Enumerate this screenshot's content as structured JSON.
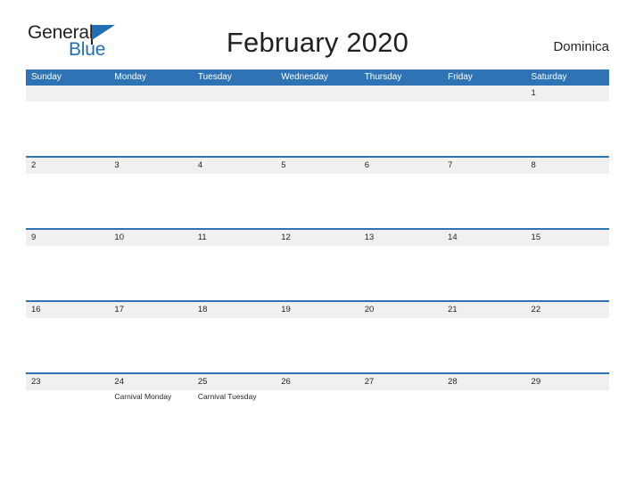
{
  "brand": {
    "name_top": "General",
    "name_bottom": "Blue",
    "flag_icon": "flag-triangle-icon",
    "accent_color": "#1f6fb5"
  },
  "header": {
    "title": "February 2020",
    "region": "Dominica"
  },
  "calendar": {
    "header_color": "#2e74b5",
    "band_color": "#f0f0f0",
    "weekdays": [
      "Sunday",
      "Monday",
      "Tuesday",
      "Wednesday",
      "Thursday",
      "Friday",
      "Saturday"
    ],
    "weeks": [
      [
        {
          "day": "",
          "events": []
        },
        {
          "day": "",
          "events": []
        },
        {
          "day": "",
          "events": []
        },
        {
          "day": "",
          "events": []
        },
        {
          "day": "",
          "events": []
        },
        {
          "day": "",
          "events": []
        },
        {
          "day": "1",
          "events": []
        }
      ],
      [
        {
          "day": "2",
          "events": []
        },
        {
          "day": "3",
          "events": []
        },
        {
          "day": "4",
          "events": []
        },
        {
          "day": "5",
          "events": []
        },
        {
          "day": "6",
          "events": []
        },
        {
          "day": "7",
          "events": []
        },
        {
          "day": "8",
          "events": []
        }
      ],
      [
        {
          "day": "9",
          "events": []
        },
        {
          "day": "10",
          "events": []
        },
        {
          "day": "11",
          "events": []
        },
        {
          "day": "12",
          "events": []
        },
        {
          "day": "13",
          "events": []
        },
        {
          "day": "14",
          "events": []
        },
        {
          "day": "15",
          "events": []
        }
      ],
      [
        {
          "day": "16",
          "events": []
        },
        {
          "day": "17",
          "events": []
        },
        {
          "day": "18",
          "events": []
        },
        {
          "day": "19",
          "events": []
        },
        {
          "day": "20",
          "events": []
        },
        {
          "day": "21",
          "events": []
        },
        {
          "day": "22",
          "events": []
        }
      ],
      [
        {
          "day": "23",
          "events": []
        },
        {
          "day": "24",
          "events": [
            "Carnival Monday"
          ]
        },
        {
          "day": "25",
          "events": [
            "Carnival Tuesday"
          ]
        },
        {
          "day": "26",
          "events": []
        },
        {
          "day": "27",
          "events": []
        },
        {
          "day": "28",
          "events": []
        },
        {
          "day": "29",
          "events": []
        }
      ]
    ]
  }
}
